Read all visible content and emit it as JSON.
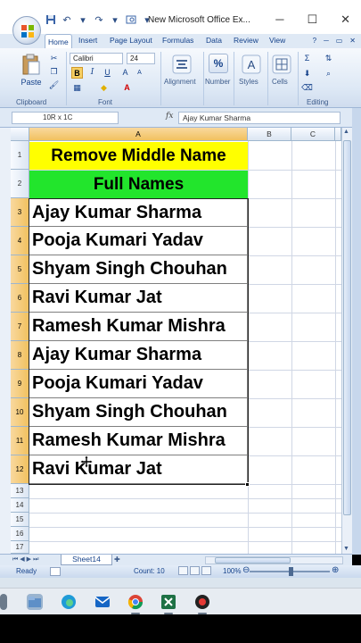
{
  "window": {
    "title": "New Microsoft Office Ex...",
    "minimize": "─",
    "maximize": "☐",
    "close": "✕"
  },
  "ribbon": {
    "tabs": [
      "Home",
      "Insert",
      "Page Layout",
      "Formulas",
      "Data",
      "Review",
      "View"
    ],
    "font_name": "Calibri",
    "font_size": "24",
    "groups": {
      "clipboard": "Clipboard",
      "font": "Font",
      "alignment": "Alignment",
      "number": "Number",
      "styles": "Styles",
      "cells": "Cells",
      "editing": "Editing"
    },
    "paste_label": "Paste",
    "number_symbol": "%"
  },
  "formula_bar": {
    "name_box": "10R x 1C",
    "fx": "fx",
    "content": "Ajay Kumar Sharma"
  },
  "grid": {
    "columns": [
      "A",
      "B",
      "C"
    ],
    "rows": [
      "1",
      "2",
      "3",
      "4",
      "5",
      "6",
      "7",
      "8",
      "9",
      "10",
      "11",
      "12",
      "13",
      "14",
      "15",
      "16",
      "17"
    ],
    "title_cell": "Remove Middle Name",
    "header_cell": "Full Names",
    "names": [
      "Ajay Kumar Sharma",
      "Pooja Kumari Yadav",
      "Shyam Singh Chouhan",
      "Ravi Kumar Jat",
      "Ramesh Kumar Mishra",
      "Ajay Kumar Sharma",
      "Pooja Kumari Yadav",
      "Shyam Singh Chouhan",
      "Ramesh Kumar Mishra",
      "Ravi Kumar Jat"
    ],
    "colors": {
      "title_bg": "#ffff00",
      "header_bg": "#22e52c"
    }
  },
  "sheets": {
    "active": "Sheet14"
  },
  "status": {
    "ready": "Ready",
    "count": "Count: 10",
    "zoom": "100%"
  }
}
